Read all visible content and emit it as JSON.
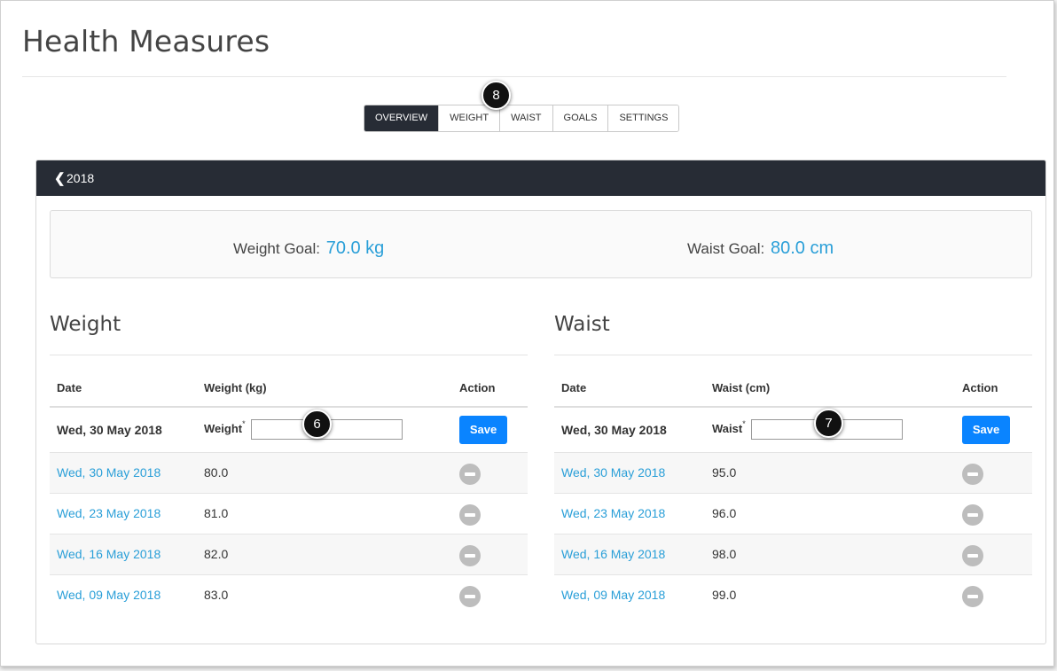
{
  "page": {
    "title": "Health Measures"
  },
  "tabs": [
    {
      "label": "OVERVIEW",
      "active": true
    },
    {
      "label": "WEIGHT",
      "active": false
    },
    {
      "label": "WAIST",
      "active": false
    },
    {
      "label": "GOALS",
      "active": false
    },
    {
      "label": "SETTINGS",
      "active": false
    }
  ],
  "markers": {
    "tabs": "8",
    "weight_input": "6",
    "waist_input": "7"
  },
  "panel": {
    "year": "2018"
  },
  "goals": {
    "weight_label": "Weight Goal:",
    "weight_value": "70.0 kg",
    "waist_label": "Waist Goal:",
    "waist_value": "80.0 cm"
  },
  "weight": {
    "heading": "Weight",
    "columns": [
      "Date",
      "Weight (kg)",
      "Action"
    ],
    "entry": {
      "date": "Wed, 30 May 2018",
      "label": "Weight",
      "required": "*",
      "value": "",
      "save": "Save"
    },
    "rows": [
      {
        "date": "Wed, 30 May 2018",
        "value": "80.0"
      },
      {
        "date": "Wed, 23 May 2018",
        "value": "81.0"
      },
      {
        "date": "Wed, 16 May 2018",
        "value": "82.0"
      },
      {
        "date": "Wed, 09 May 2018",
        "value": "83.0"
      }
    ]
  },
  "waist": {
    "heading": "Waist",
    "columns": [
      "Date",
      "Waist (cm)",
      "Action"
    ],
    "entry": {
      "date": "Wed, 30 May 2018",
      "label": "Waist",
      "required": "*",
      "value": "",
      "save": "Save"
    },
    "rows": [
      {
        "date": "Wed, 30 May 2018",
        "value": "95.0"
      },
      {
        "date": "Wed, 23 May 2018",
        "value": "96.0"
      },
      {
        "date": "Wed, 16 May 2018",
        "value": "98.0"
      },
      {
        "date": "Wed, 09 May 2018",
        "value": "99.0"
      }
    ]
  },
  "colors": {
    "header_bg": "#272c35",
    "link": "#2a9fd8",
    "save_button": "#0a84ff",
    "remove_icon": "#bdbdbd"
  },
  "icons": {
    "back": "chevron-left-icon",
    "remove": "minus-circle-icon"
  }
}
